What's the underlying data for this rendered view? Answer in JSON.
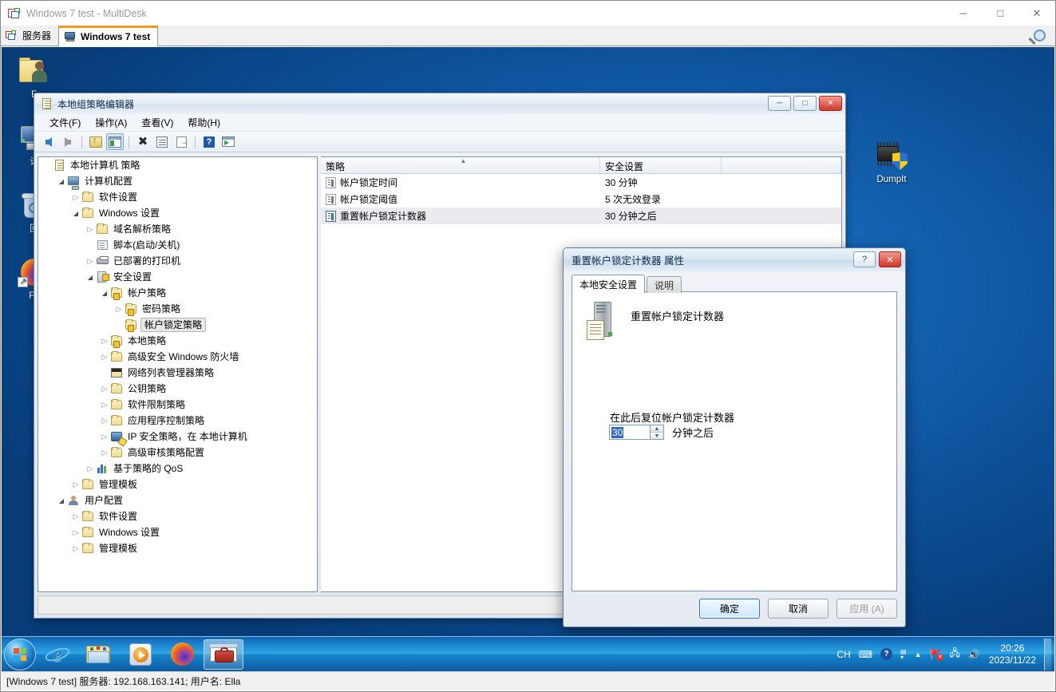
{
  "window": {
    "title": "Windows 7 test - MultiDesk",
    "icon": "multidesk-icon",
    "minimize": "─",
    "maximize": "□",
    "close": "✕",
    "tabs": [
      {
        "label": "服务器",
        "icon": "server-icon",
        "active": false
      },
      {
        "label": "Windows 7 test",
        "icon": "monitor-icon",
        "active": true
      }
    ],
    "magnifier": "search-icon"
  },
  "desktop": {
    "icons": [
      {
        "name": "user-folder",
        "label": "E"
      },
      {
        "name": "computer",
        "label": "计"
      },
      {
        "name": "recycle-bin",
        "label": "回"
      },
      {
        "name": "firefox",
        "label": "Fir"
      },
      {
        "name": "dumpit",
        "label": "DumpIt"
      }
    ]
  },
  "mmc": {
    "title": "本地组策略编辑器",
    "window_buttons": {
      "minimize": "─",
      "maximize": "□",
      "close": "✕"
    },
    "menus": [
      "文件(F)",
      "操作(A)",
      "查看(V)",
      "帮助(H)"
    ],
    "toolbar": [
      "back-icon",
      "forward-icon",
      "up-folder-icon",
      "show-console-tree-icon",
      "delete-icon",
      "properties-icon",
      "export-list-icon",
      "help-icon",
      "show-action-pane-icon"
    ],
    "tree": [
      {
        "label": "本地计算机 策略",
        "indent": 0,
        "expander": "none",
        "icon": "policy-doc-icon"
      },
      {
        "label": "计算机配置",
        "indent": 1,
        "expander": "open",
        "icon": "computer-icon"
      },
      {
        "label": "软件设置",
        "indent": 2,
        "expander": "closed",
        "icon": "folder-icon"
      },
      {
        "label": "Windows 设置",
        "indent": 2,
        "expander": "open",
        "icon": "folder-icon"
      },
      {
        "label": "域名解析策略",
        "indent": 3,
        "expander": "closed",
        "icon": "folder-icon"
      },
      {
        "label": "脚本(启动/关机)",
        "indent": 3,
        "expander": "none",
        "icon": "script-icon"
      },
      {
        "label": "已部署的打印机",
        "indent": 3,
        "expander": "closed",
        "icon": "printer-icon"
      },
      {
        "label": "安全设置",
        "indent": 3,
        "expander": "open",
        "icon": "security-settings-icon"
      },
      {
        "label": "帐户策略",
        "indent": 4,
        "expander": "open",
        "icon": "folder-lock-icon"
      },
      {
        "label": "密码策略",
        "indent": 5,
        "expander": "closed",
        "icon": "folder-lock-icon"
      },
      {
        "label": "帐户锁定策略",
        "indent": 5,
        "expander": "none",
        "icon": "folder-lock-icon",
        "selected": true
      },
      {
        "label": "本地策略",
        "indent": 4,
        "expander": "closed",
        "icon": "folder-lock-icon"
      },
      {
        "label": "高级安全 Windows 防火墙",
        "indent": 4,
        "expander": "closed",
        "icon": "folder-icon"
      },
      {
        "label": "网络列表管理器策略",
        "indent": 4,
        "expander": "none",
        "icon": "network-list-icon"
      },
      {
        "label": "公钥策略",
        "indent": 4,
        "expander": "closed",
        "icon": "folder-icon"
      },
      {
        "label": "软件限制策略",
        "indent": 4,
        "expander": "closed",
        "icon": "folder-icon"
      },
      {
        "label": "应用程序控制策略",
        "indent": 4,
        "expander": "closed",
        "icon": "folder-icon"
      },
      {
        "label": "IP 安全策略，在 本地计算机",
        "indent": 4,
        "expander": "closed",
        "icon": "ipsec-icon"
      },
      {
        "label": "高级审核策略配置",
        "indent": 4,
        "expander": "closed",
        "icon": "folder-icon"
      },
      {
        "label": "基于策略的 QoS",
        "indent": 3,
        "expander": "closed",
        "icon": "qos-icon"
      },
      {
        "label": "管理模板",
        "indent": 2,
        "expander": "closed",
        "icon": "folder-icon"
      },
      {
        "label": "用户配置",
        "indent": 1,
        "expander": "open",
        "icon": "user-icon"
      },
      {
        "label": "软件设置",
        "indent": 2,
        "expander": "closed",
        "icon": "folder-icon"
      },
      {
        "label": "Windows 设置",
        "indent": 2,
        "expander": "closed",
        "icon": "folder-icon"
      },
      {
        "label": "管理模板",
        "indent": 2,
        "expander": "closed",
        "icon": "folder-icon"
      }
    ],
    "list": {
      "columns": [
        "策略",
        "安全设置",
        ""
      ],
      "sorted_column": "策略",
      "rows": [
        {
          "policy": "帐户锁定时间",
          "setting": "30 分钟",
          "selected": false
        },
        {
          "policy": "帐户锁定阈值",
          "setting": "5 次无效登录",
          "selected": false
        },
        {
          "policy": "重置帐户锁定计数器",
          "setting": "30 分钟之后",
          "selected": true
        }
      ]
    }
  },
  "dialog": {
    "title": "重置帐户锁定计数器 属性",
    "help_button": "?",
    "close_button": "✕",
    "tabs": [
      {
        "label": "本地安全设置",
        "active": true
      },
      {
        "label": "说明",
        "active": false
      }
    ],
    "policy_icon": "server-policy-icon",
    "policy_name": "重置帐户锁定计数器",
    "field_label": "在此后复位帐户锁定计数器",
    "field_value": "30",
    "field_unit": "分钟之后",
    "spinner_up": "▲",
    "spinner_down": "▼",
    "buttons": [
      {
        "label": "确定",
        "style": "default"
      },
      {
        "label": "取消",
        "style": "normal"
      },
      {
        "label": "应用 (A)",
        "style": "disabled"
      }
    ]
  },
  "taskbar": {
    "start": "start-orb",
    "items": [
      {
        "name": "internet-explorer",
        "active": false
      },
      {
        "name": "windows-explorer",
        "active": false
      },
      {
        "name": "windows-media-player",
        "active": false
      },
      {
        "name": "firefox",
        "active": false
      },
      {
        "name": "mmc-toolbox",
        "active": true
      }
    ],
    "tray": {
      "ime": "CH",
      "icons": [
        "keyboard-icon",
        "help-icon",
        "network-expand-icon",
        "show-hidden-icon",
        "action-center-icon",
        "network-icon",
        "volume-icon"
      ],
      "time": "20:26",
      "date": "2023/11/22"
    }
  },
  "statusbar": {
    "text": "[Windows 7 test] 服务器: 192.168.163.141; 用户名: Ella"
  }
}
